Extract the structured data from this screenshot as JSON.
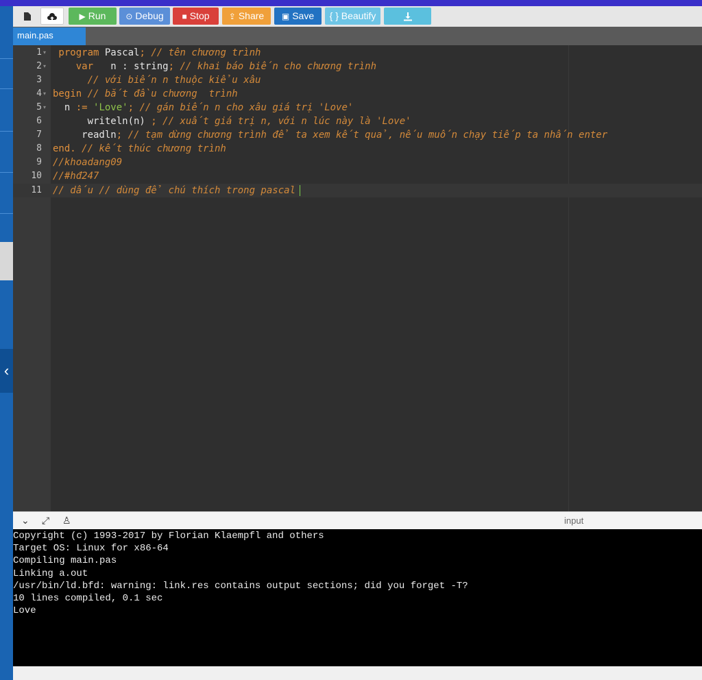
{
  "toolbar": {
    "buttons": [
      {
        "label": "",
        "icon": "file-icon",
        "color": "#e6e6e6"
      },
      {
        "label": "",
        "icon": "cloud-upload-icon",
        "color": "#ffffff"
      },
      {
        "label": "Run",
        "icon": "play-icon",
        "color": "#5cb85c"
      },
      {
        "label": "Debug",
        "icon": "debug-icon",
        "color": "#5b8fd8"
      },
      {
        "label": "Stop",
        "icon": "stop-icon",
        "color": "#d9403a"
      },
      {
        "label": "Share",
        "icon": "share-icon",
        "color": "#f0a03a"
      },
      {
        "label": "Save",
        "icon": "save-icon",
        "color": "#2272c2"
      },
      {
        "label": "{ } Beautify",
        "icon": "beautify-icon",
        "color": "#6ec5e6"
      },
      {
        "label": "",
        "icon": "download-icon",
        "color": "#5bc0de"
      }
    ]
  },
  "tab": {
    "name": "main.pas"
  },
  "editor": {
    "active_line": 11,
    "lines": [
      {
        "n": "1",
        "fold": true
      },
      {
        "n": "2",
        "fold": true
      },
      {
        "n": "3",
        "fold": false
      },
      {
        "n": "4",
        "fold": true
      },
      {
        "n": "5",
        "fold": true
      },
      {
        "n": "6",
        "fold": false
      },
      {
        "n": "7",
        "fold": false
      },
      {
        "n": "8",
        "fold": false
      },
      {
        "n": "9",
        "fold": false
      },
      {
        "n": "10",
        "fold": false
      },
      {
        "n": "11",
        "fold": false
      }
    ],
    "tokens": {
      "l1a": " program",
      "l1b": " Pascal",
      "l1c": ";",
      "l1d": " // tên chương trình",
      "l2a": "    var",
      "l2b": "   n : string",
      "l2c": ";",
      "l2d": " // khai báo biến cho chương trình",
      "l3a": "      // với biến n thuộc kiểu xâu",
      "l4a": "begin",
      "l4b": " // bắt đầu chương  trình",
      "l5a": "  n",
      "l5b": " :=",
      "l5c": " 'Love'",
      "l5d": ";",
      "l5e": " // gán biến n cho xâu giá trị 'Love'",
      "l6a": "      writeln(n)",
      "l6b": " ;",
      "l6c": " // xuất giá trị n, với n lúc này là 'Love'",
      "l7a": "     readln",
      "l7b": ";",
      "l7c": " // tạm dừng chương trình để ta xem kết quả, nếu muốn chạy tiếp ta nhấn enter",
      "l8a": "end.",
      "l8b": " // kết thúc chương trình",
      "l9a": "//khoadang09",
      "l10a": "//#hđ247",
      "l11a": "// dấu // dùng để chú thích trong pascal"
    }
  },
  "output_bar": {
    "input_label": "input"
  },
  "output": {
    "lines": [
      "Copyright (c) 1993-2017 by Florian Klaempfl and others",
      "Target OS: Linux for x86-64",
      "Compiling main.pas",
      "Linking a.out",
      "/usr/bin/ld.bfd: warning: link.res contains output sections; did you forget -T?",
      "10 lines compiled, 0.1 sec",
      "Love"
    ]
  }
}
